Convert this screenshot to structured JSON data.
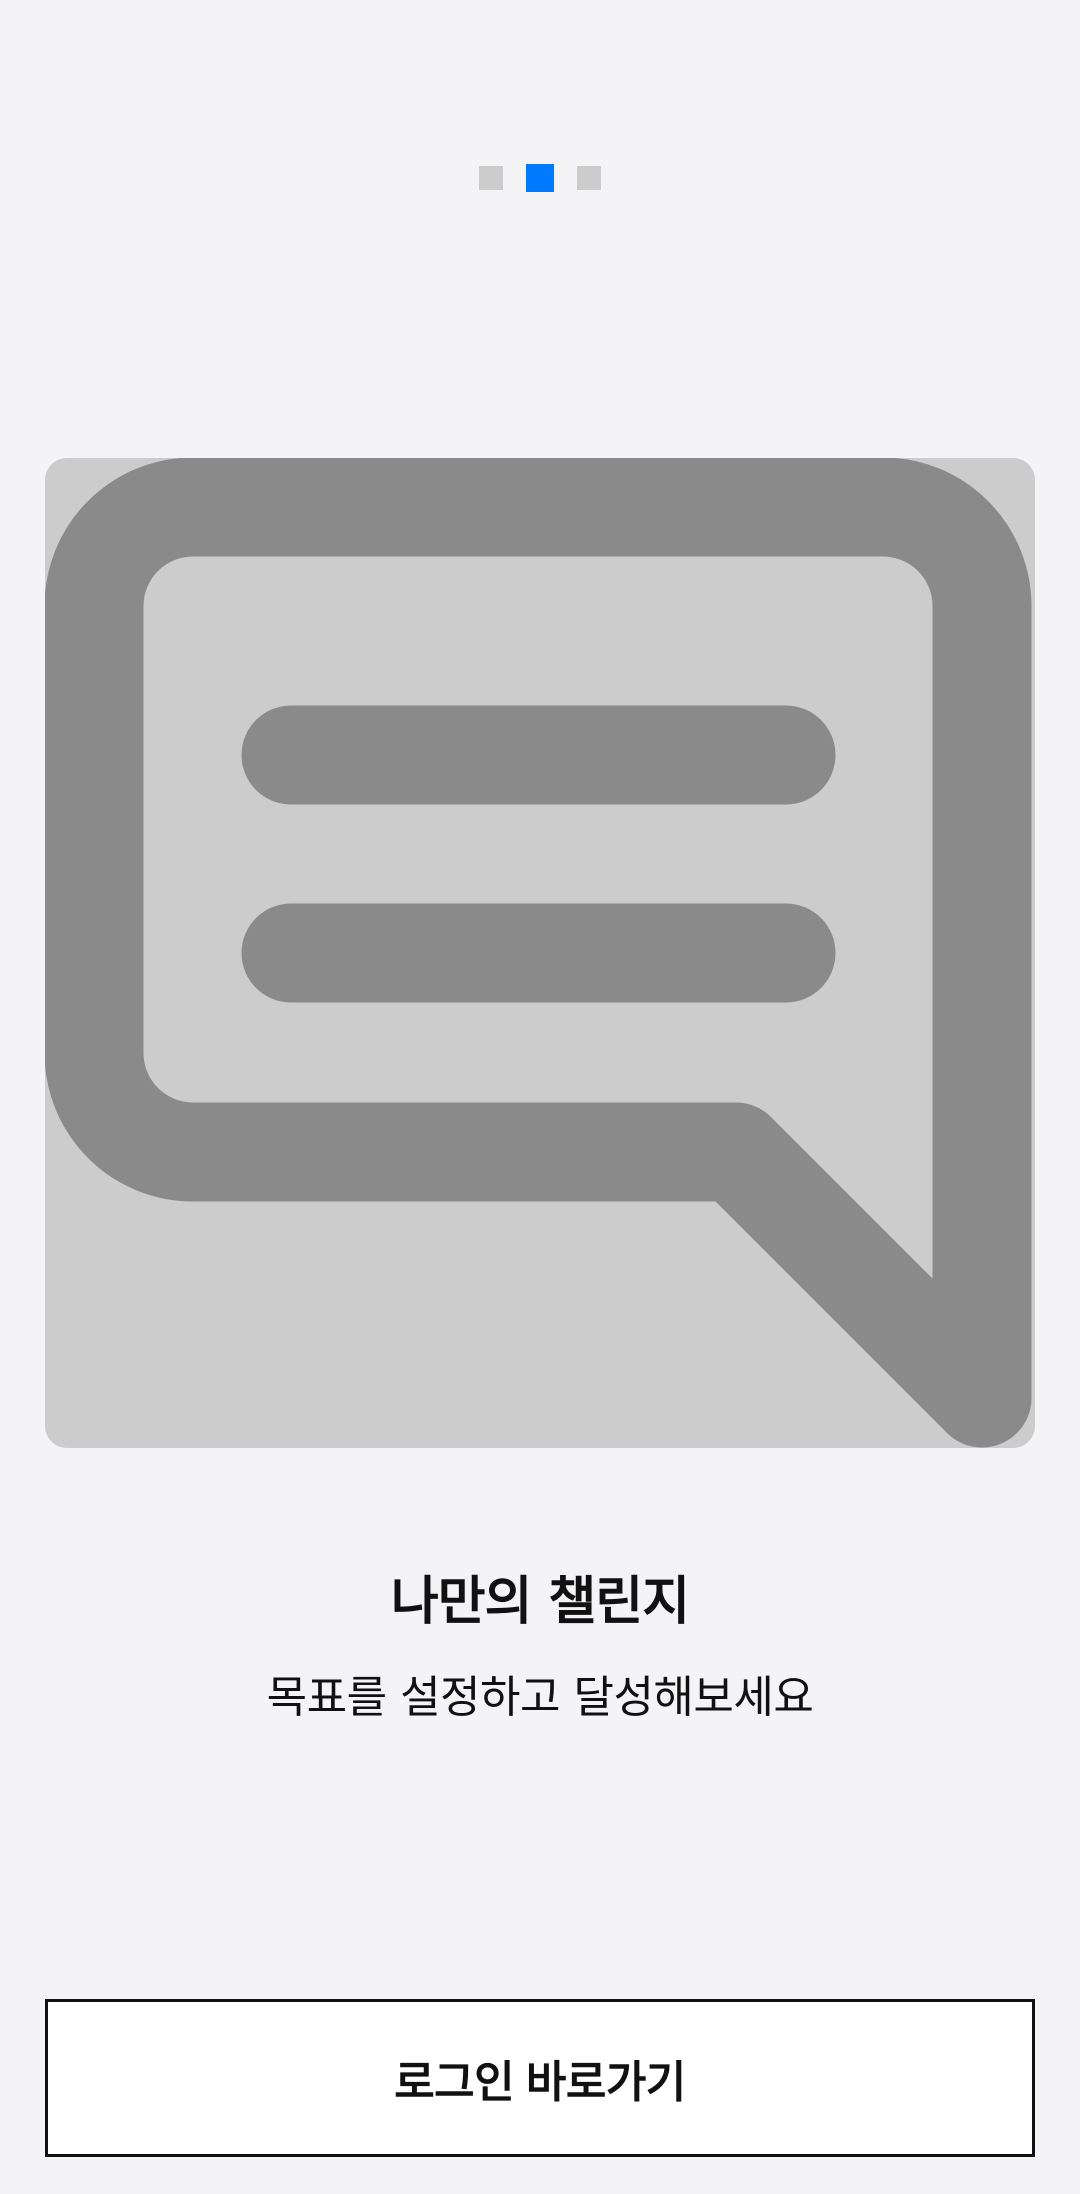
{
  "pager": {
    "page_count": 3,
    "active_index": 1,
    "active_color": "#007aff",
    "inactive_color": "#cccccc"
  },
  "illustration": {
    "icon": "chat-bubble-icon",
    "background_color": "#cccccc",
    "icon_color": "#8a8a8a"
  },
  "onboarding": {
    "title": "나만의 챌린지",
    "subtitle": "목표를 설정하고 달성해보세요"
  },
  "actions": {
    "login_label": "로그인 바로가기"
  }
}
